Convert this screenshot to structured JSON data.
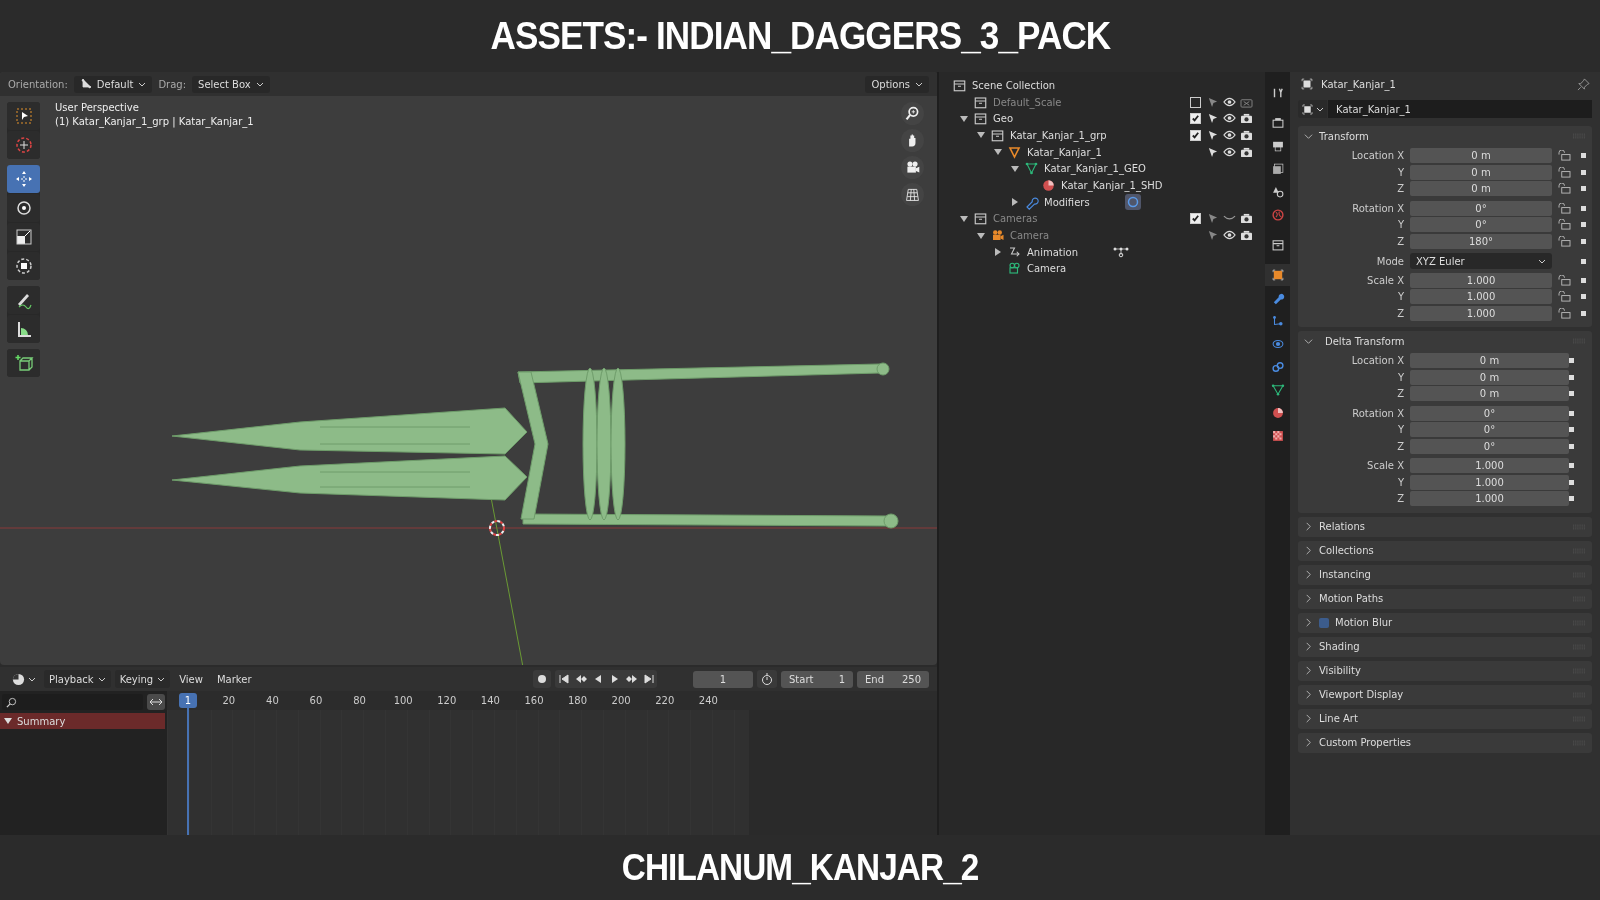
{
  "header_title": "ASSETS:- INDIAN_DAGGERS_3_PACK",
  "footer_title": "CHILANUM_KANJAR_2",
  "viewport": {
    "orientation_label": "Orientation:",
    "orientation_value": "Default",
    "drag_label": "Drag:",
    "drag_value": "Select Box",
    "options": "Options",
    "view_name": "User Perspective",
    "object_path": "(1) Katar_Kanjar_1_grp | Katar_Kanjar_1",
    "tool_groups": [
      [
        {
          "kind": "select_box",
          "selected": false
        },
        {
          "kind": "cursor",
          "selected": false
        }
      ],
      [
        {
          "kind": "move",
          "selected": true
        },
        {
          "kind": "rotate",
          "selected": false
        },
        {
          "kind": "scale",
          "selected": false
        },
        {
          "kind": "transform",
          "selected": false
        }
      ],
      [
        {
          "kind": "annotate",
          "selected": false
        },
        {
          "kind": "measure",
          "selected": false
        }
      ],
      [
        {
          "kind": "add_cube",
          "selected": false
        }
      ]
    ],
    "nav_buttons": [
      {
        "kind": "zoom"
      },
      {
        "kind": "pan"
      },
      {
        "kind": "camera"
      },
      {
        "kind": "grid"
      }
    ]
  },
  "timeline": {
    "menus": [
      {
        "label": "Playback",
        "dropdown": true
      },
      {
        "label": "Keying",
        "dropdown": true
      },
      {
        "label": "View",
        "dropdown": false
      },
      {
        "label": "Marker",
        "dropdown": false
      }
    ],
    "current_frame": "1",
    "start_label": "Start",
    "start": "1",
    "end_label": "End",
    "end": "250",
    "cursor_frame": "1",
    "ticks": [
      "20",
      "40",
      "60",
      "80",
      "100",
      "120",
      "140",
      "160",
      "180",
      "200",
      "220",
      "240"
    ],
    "channels": [
      {
        "label": "Summary",
        "expanded": true
      }
    ]
  },
  "outliner": {
    "root": "Scene Collection",
    "items": [
      {
        "name": "Default_Scale",
        "kind": "collection",
        "dimmed": true,
        "checked": false,
        "visible": true,
        "renderable": false
      },
      {
        "name": "Geo",
        "kind": "collection",
        "dimmed": false,
        "expanded": true,
        "checked": true,
        "visible": true,
        "renderable": true,
        "children": [
          {
            "name": "Katar_Kanjar_1_grp",
            "kind": "collection",
            "dimmed": false,
            "expanded": true,
            "checked": true,
            "visible": true,
            "renderable": true,
            "children": [
              {
                "name": "Katar_Kanjar_1",
                "kind": "mesh_object",
                "dimmed": false,
                "expanded": true,
                "visible": true,
                "renderable": true,
                "children": [
                  {
                    "name": "Katar_Kanjar_1_GEO",
                    "kind": "mesh",
                    "dimmed": false,
                    "expanded": true,
                    "children": [
                      {
                        "name": "Katar_Kanjar_1_SHD",
                        "kind": "material",
                        "dimmed": false
                      }
                    ]
                  },
                  {
                    "name": "Modifiers",
                    "kind": "modifiers",
                    "dimmed": false,
                    "expanded": false
                  }
                ]
              }
            ]
          }
        ]
      },
      {
        "name": "Cameras",
        "kind": "collection",
        "dimmed": true,
        "expanded": true,
        "checked": true,
        "visible": false,
        "renderable": true,
        "children": [
          {
            "name": "Camera",
            "kind": "camera_object",
            "dimmed": true,
            "expanded": true,
            "visible": true,
            "renderable": true,
            "children": [
              {
                "name": "Animation",
                "kind": "animation",
                "dimmed": false,
                "expanded": false
              },
              {
                "name": "Camera",
                "kind": "camera_data",
                "dimmed": false
              }
            ]
          }
        ]
      }
    ]
  },
  "properties": {
    "tab_groups": [
      [
        {
          "kind": "tool",
          "selected": false
        }
      ],
      [
        {
          "kind": "render",
          "selected": false
        },
        {
          "kind": "output",
          "selected": false
        },
        {
          "kind": "view_layer",
          "selected": false
        },
        {
          "kind": "scene",
          "selected": false
        },
        {
          "kind": "world",
          "selected": false
        }
      ],
      [
        {
          "kind": "collection",
          "selected": false
        }
      ],
      [
        {
          "kind": "object",
          "selected": true
        },
        {
          "kind": "modifiers",
          "selected": false
        },
        {
          "kind": "particles",
          "selected": false
        },
        {
          "kind": "physics",
          "selected": false
        },
        {
          "kind": "constraints",
          "selected": false
        },
        {
          "kind": "data",
          "selected": false
        },
        {
          "kind": "material",
          "selected": false
        },
        {
          "kind": "texture",
          "selected": false
        }
      ]
    ],
    "object_name": "Katar_Kanjar_1",
    "data_name": "Katar_Kanjar_1",
    "sections": [
      {
        "title": "Transform",
        "expanded": true,
        "groups": [
          [
            {
              "label": "Location X",
              "value": "0 m",
              "locked": false
            },
            {
              "label": "Y",
              "value": "0 m",
              "locked": false
            },
            {
              "label": "Z",
              "value": "0 m",
              "locked": false
            }
          ],
          [
            {
              "label": "Rotation X",
              "value": "0°",
              "locked": false
            },
            {
              "label": "Y",
              "value": "0°",
              "locked": false
            },
            {
              "label": "Z",
              "value": "180°",
              "locked": false
            }
          ],
          [
            {
              "label": "Mode",
              "value": "XYZ Euler",
              "kind": "dropdown"
            }
          ],
          [
            {
              "label": "Scale X",
              "value": "1.000",
              "locked": false
            },
            {
              "label": "Y",
              "value": "1.000",
              "locked": false
            },
            {
              "label": "Z",
              "value": "1.000",
              "locked": false
            }
          ]
        ]
      },
      {
        "title": "Delta Transform",
        "expanded": true,
        "groups": [
          [
            {
              "label": "Location X",
              "value": "0 m"
            },
            {
              "label": "Y",
              "value": "0 m"
            },
            {
              "label": "Z",
              "value": "0 m"
            }
          ],
          [
            {
              "label": "Rotation X",
              "value": "0°"
            },
            {
              "label": "Y",
              "value": "0°"
            },
            {
              "label": "Z",
              "value": "0°"
            }
          ],
          [
            {
              "label": "Scale X",
              "value": "1.000"
            },
            {
              "label": "Y",
              "value": "1.000"
            },
            {
              "label": "Z",
              "value": "1.000"
            }
          ]
        ]
      },
      {
        "title": "Relations",
        "expanded": false
      },
      {
        "title": "Collections",
        "expanded": false
      },
      {
        "title": "Instancing",
        "expanded": false
      },
      {
        "title": "Motion Paths",
        "expanded": false
      },
      {
        "title": "Motion Blur",
        "expanded": false,
        "checked": true
      },
      {
        "title": "Shading",
        "expanded": false
      },
      {
        "title": "Visibility",
        "expanded": false
      },
      {
        "title": "Viewport Display",
        "expanded": false
      },
      {
        "title": "Line Art",
        "expanded": false
      },
      {
        "title": "Custom Properties",
        "expanded": false
      }
    ]
  }
}
